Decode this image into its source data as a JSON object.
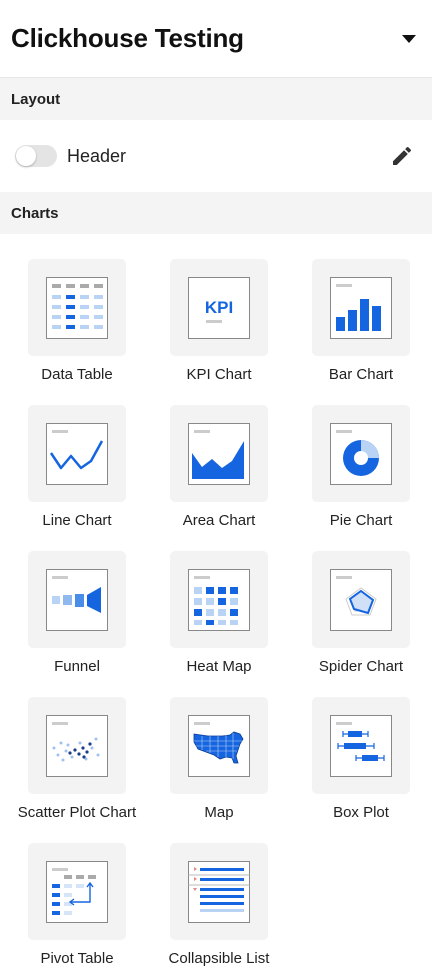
{
  "header": {
    "title": "Clickhouse Testing",
    "menu_icon": "caret-down-icon"
  },
  "layout": {
    "section_title": "Layout",
    "toggle_label": "Header",
    "toggle_on": false,
    "edit_icon": "pencil-icon"
  },
  "charts": {
    "section_title": "Charts",
    "items": [
      {
        "label": "Data Table",
        "icon": "data-table-icon"
      },
      {
        "label": "KPI Chart",
        "icon": "kpi-chart-icon",
        "icon_text": "KPI"
      },
      {
        "label": "Bar Chart",
        "icon": "bar-chart-icon"
      },
      {
        "label": "Line Chart",
        "icon": "line-chart-icon"
      },
      {
        "label": "Area Chart",
        "icon": "area-chart-icon"
      },
      {
        "label": "Pie Chart",
        "icon": "pie-chart-icon"
      },
      {
        "label": "Funnel",
        "icon": "funnel-icon"
      },
      {
        "label": "Heat Map",
        "icon": "heat-map-icon"
      },
      {
        "label": "Spider Chart",
        "icon": "spider-chart-icon"
      },
      {
        "label": "Scatter Plot Chart",
        "icon": "scatter-plot-icon"
      },
      {
        "label": "Map",
        "icon": "map-icon"
      },
      {
        "label": "Box Plot",
        "icon": "box-plot-icon"
      },
      {
        "label": "Pivot Table",
        "icon": "pivot-table-icon"
      },
      {
        "label": "Collapsible List",
        "icon": "collapsible-list-icon"
      }
    ]
  },
  "colors": {
    "accent": "#1565e0",
    "accent_light": "#b9d3f5",
    "tile_bg": "#f3f3f3",
    "section_bg": "#f4f4f4"
  }
}
